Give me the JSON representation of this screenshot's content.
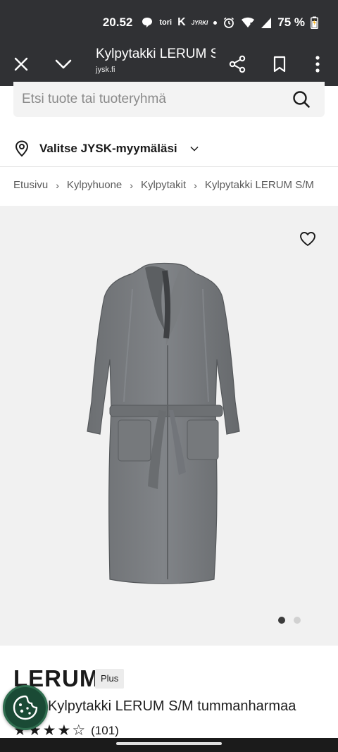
{
  "status_bar": {
    "time": "20.52",
    "app_tori": "tori",
    "app_k": "K",
    "app_jyrki": "JYRKI",
    "battery": "75 %"
  },
  "custom_tab": {
    "title": "Kylpytakki LERUM S/M tummanharmaa",
    "url": "jysk.fi"
  },
  "search": {
    "placeholder": "Etsi tuote tai tuoteryhmä"
  },
  "store": {
    "label": "Valitse JYSK-myymäläsi"
  },
  "breadcrumb": [
    "Etusivu",
    "Kylpyhuone",
    "Kylpytakit",
    "Kylpytakki LERUM S/M"
  ],
  "gallery": {
    "image_count": 2,
    "active_index": 0
  },
  "product": {
    "brand": "LERUM",
    "badge": "Plus",
    "name": "Kylpytakki LERUM S/M tummanharmaa",
    "rating_stars": 4,
    "rating_max": 5,
    "rating_count": "(101)"
  },
  "icons": {
    "close": "close-icon",
    "collapse": "chevron-down-icon",
    "share": "share-icon",
    "bookmark": "bookmark-icon",
    "menu": "more-vert-icon",
    "search": "search-icon",
    "store": "location-pin-icon",
    "favorite": "heart-icon",
    "cookie": "cookie-icon"
  },
  "colors": {
    "chrome": "#303134",
    "gallery_bg": "#f1f1f1",
    "cookie_bg": "#1a4a35",
    "robe": "#74777a"
  }
}
